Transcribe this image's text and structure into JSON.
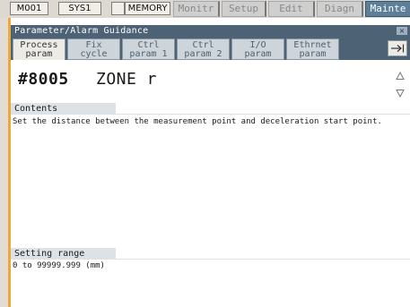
{
  "status": {
    "mode_code": "M001",
    "system": "SYS1",
    "blank": "",
    "operation_mode": "MEMORY"
  },
  "mode_tabs": [
    "Monitr",
    "Setup",
    "Edit",
    "Diagn",
    "Mainte"
  ],
  "window": {
    "title": "Parameter/Alarm Guidance",
    "close_label": "×"
  },
  "tabs": [
    {
      "line1": "Process",
      "line2": "param"
    },
    {
      "line1": "Fix",
      "line2": "cycle"
    },
    {
      "line1": "Ctrl",
      "line2": "param 1"
    },
    {
      "line1": "Ctrl",
      "line2": "param 2"
    },
    {
      "line1": "I/O",
      "line2": "param"
    },
    {
      "line1": "Ethrnet",
      "line2": "param"
    }
  ],
  "param": {
    "number": "#8005",
    "name": "ZONE r"
  },
  "contents": {
    "label": "Contents",
    "text": "Set the distance between the measurement point and deceleration start point."
  },
  "setting_range": {
    "label": "Setting range",
    "text": "0 to 99999.999 (mm)"
  }
}
